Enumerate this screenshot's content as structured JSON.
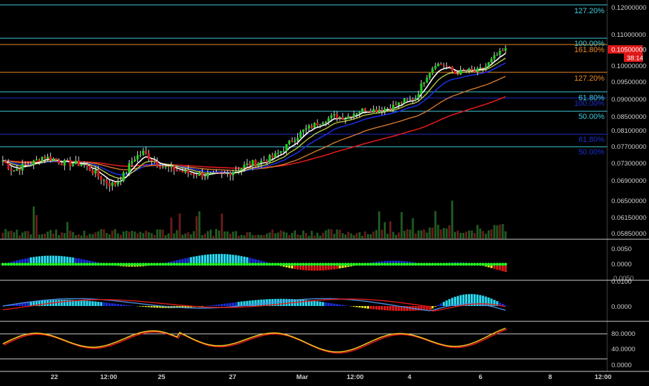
{
  "colors": {
    "background": "#000000",
    "separator": "#cfcfcf",
    "candle_up": "#22cc22",
    "candle_down": "#e01818",
    "price_badge": "#e01818",
    "fib_cyan": "#3fd0e0",
    "fib_orange": "#f08a24",
    "fib_blue": "#1c2fd0",
    "ema_white": "#ffffff",
    "ema_olive": "#b8c844",
    "ema_blue": "#1a2fe0",
    "ema_orange": "#d87a2c",
    "ema_red": "#e21a1a",
    "volume": "#1f5a1f"
  },
  "price_axis": {
    "ticks": [
      "0.12000000",
      "0.11000000",
      "0.10000000",
      "0.09500000",
      "0.09000000",
      "0.08500000",
      "0.08100000",
      "0.07700000",
      "0.07300000",
      "0.06900000",
      "0.06500000",
      "0.06150000",
      "0.05850000"
    ],
    "current_price": "0.10500000",
    "countdown": "38:14"
  },
  "fib_labels": [
    {
      "text": "127.20%",
      "color": "cyan"
    },
    {
      "text": "100.00%",
      "color": "cyan"
    },
    {
      "text": "161.80%",
      "color": "orange"
    },
    {
      "text": "127.20%",
      "color": "orange"
    },
    {
      "text": "61.80%",
      "color": "cyan"
    },
    {
      "text": "100.00%",
      "color": "blue"
    },
    {
      "text": "50.00%",
      "color": "cyan"
    },
    {
      "text": "61.80%",
      "color": "blue"
    },
    {
      "text": "50.00%",
      "color": "blue"
    }
  ],
  "time_axis": [
    "22",
    "12:00",
    "25",
    "27",
    "Mar",
    "12:00",
    "4",
    "6",
    "8",
    "12:00"
  ],
  "panels": {
    "histogram": {
      "ticks": [
        "0.0050",
        "0.0000"
      ]
    },
    "macd": {
      "ticks": [
        "0.0100",
        "0.0000"
      ],
      "overlap_tick": "0.0050"
    },
    "stoch": {
      "ticks": [
        "80.0000",
        "40.0000",
        "0.0000"
      ],
      "levels": [
        80,
        20
      ]
    }
  },
  "chart_data": {
    "type": "candlestick",
    "series_note": "price path estimated from chart",
    "points": [
      0.0735,
      0.0712,
      0.0722,
      0.073,
      0.0745,
      0.0739,
      0.073,
      0.0728,
      0.0727,
      0.071,
      0.069,
      0.068,
      0.07,
      0.074,
      0.0755,
      0.0735,
      0.072,
      0.0715,
      0.0708,
      0.0705,
      0.0702,
      0.07,
      0.0703,
      0.0712,
      0.0722,
      0.073,
      0.0735,
      0.0745,
      0.0765,
      0.079,
      0.081,
      0.0825,
      0.084,
      0.085,
      0.0845,
      0.086,
      0.087,
      0.0868,
      0.0872,
      0.088,
      0.0895,
      0.09,
      0.096,
      0.1005,
      0.1,
      0.0975,
      0.0985,
      0.098,
      0.0995,
      0.103,
      0.105
    ]
  }
}
